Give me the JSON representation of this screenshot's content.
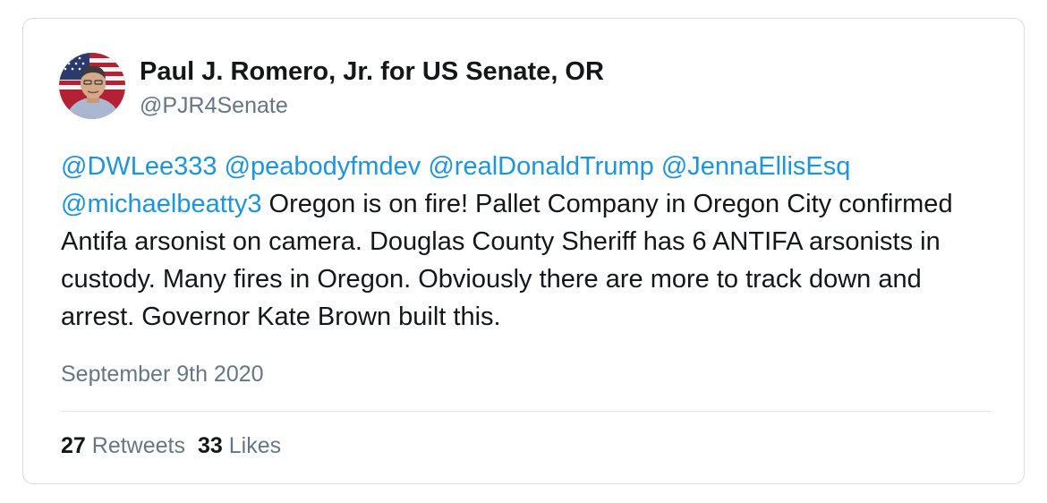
{
  "tweet": {
    "author_name": "Paul J. Romero, Jr. for US Senate, OR",
    "author_handle": "@PJR4Senate",
    "avatar_icon": "profile-photo-flag",
    "mentions": [
      "@DWLee333",
      "@peabodyfmdev",
      "@realDonaldTrump",
      "@JennaEllisEsq",
      "@michaelbeatty3"
    ],
    "body_text": " Oregon is on fire!  Pallet Company in Oregon City confirmed Antifa arsonist on camera. Douglas County Sheriff has 6 ANTIFA arsonists in custody. Many fires in Oregon. Obviously there are more to track down and arrest. Governor Kate Brown built this.",
    "date": "September 9th 2020",
    "stats": {
      "retweets_count": "27",
      "retweets_label": "Retweets",
      "likes_count": "33",
      "likes_label": "Likes"
    }
  },
  "colors": {
    "mention": "#1b95e0",
    "text": "#14171a",
    "secondary": "#657786",
    "border": "#d6dde3"
  }
}
